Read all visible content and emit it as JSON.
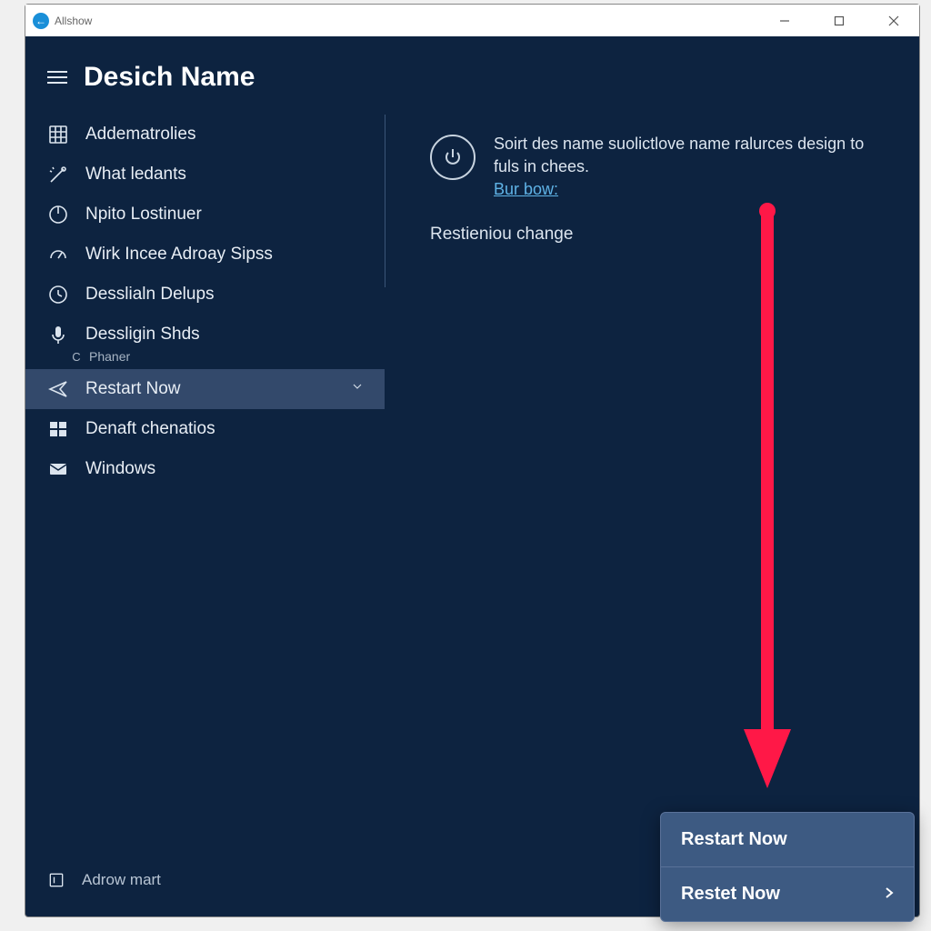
{
  "titlebar": {
    "title": "Allshow"
  },
  "header": {
    "title": "Desich Name"
  },
  "sidebar": {
    "items": [
      {
        "icon": "grid-icon",
        "label": "Addematrolies"
      },
      {
        "icon": "wand-icon",
        "label": "What ledants"
      },
      {
        "icon": "power-small-icon",
        "label": "Npito Lostinuer"
      },
      {
        "icon": "gauge-icon",
        "label": "Wirk Incee Adroay Sipss"
      },
      {
        "icon": "clock-icon",
        "label": "Desslialn Delups"
      },
      {
        "icon": "mic-icon",
        "label": "Dessligin Shds",
        "sub": "Phaner"
      },
      {
        "icon": "plane-icon",
        "label": "Restart Now",
        "selected": true
      },
      {
        "icon": "windows-icon",
        "label": "Denaft chenatios"
      },
      {
        "icon": "mail-icon",
        "label": "Windows"
      }
    ],
    "bottom": {
      "label": "Adrow mart"
    }
  },
  "main": {
    "info_text": "Soirt des name suolictlove name ralurces design to fuls in chees.",
    "info_link": "Bur bow:",
    "section": "Restieniou change"
  },
  "popup": {
    "items": [
      {
        "label": "Restart Now"
      },
      {
        "label": "Restet Now"
      }
    ]
  }
}
